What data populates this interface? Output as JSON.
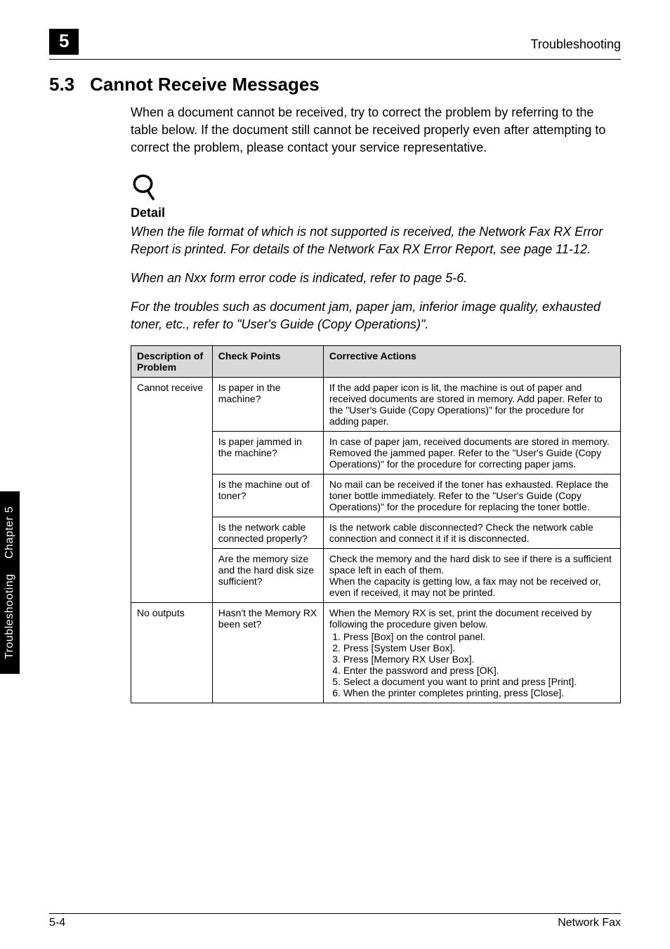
{
  "header": {
    "badge": "5",
    "label": "Troubleshooting"
  },
  "section": {
    "number": "5.3",
    "title": "Cannot Receive Messages"
  },
  "intro_paragraph": "When a document cannot be received, try to correct the problem by referring to the table below. If the document still cannot be received properly even after attempting to correct the problem, please contact your service representative.",
  "icon_name": "magnifier-icon",
  "detail": {
    "heading": "Detail",
    "para1": "When the file format of which is not supported is received, the Network Fax RX Error Report is printed. For details of the Network Fax RX Error Report, see page 11-12.",
    "para2": "When an Nxx form error code is indicated, refer to page 5-6.",
    "para3": "For the troubles such as document jam, paper jam, inferior image quality, exhausted toner, etc., refer to \"User's Guide (Copy Operations)\"."
  },
  "table": {
    "headers": {
      "col1": "Description of Problem",
      "col2": "Check Points",
      "col3": "Corrective Actions"
    },
    "rows": [
      {
        "problem": "Cannot receive",
        "check": "Is paper in the machine?",
        "action_text": "If the add paper icon is lit, the machine is out of paper and received documents are stored in memory. Add paper. Refer to the \"User's Guide (Copy Operations)\" for the procedure for adding paper."
      },
      {
        "problem": "",
        "check": "Is paper jammed in the machine?",
        "action_text": "In case of paper jam, received documents are stored in memory. Removed the jammed paper. Refer to the \"User's Guide (Copy Operations)\" for the procedure for correcting paper jams."
      },
      {
        "problem": "",
        "check": "Is the machine out of toner?",
        "action_text": "No mail can be received if the toner has exhausted. Replace the toner bottle immediately. Refer to the \"User's Guide (Copy Operations)\" for the procedure for replacing the toner bottle."
      },
      {
        "problem": "",
        "check": "Is the network cable connected properly?",
        "action_text": "Is the network cable disconnected? Check the network cable connection and connect it if it is disconnected."
      },
      {
        "problem": "",
        "check": "Are the memory size and the hard disk size sufficient?",
        "action_text": "Check the memory and the hard disk to see if there is a sufficient space left in each of them.\nWhen the capacity is getting low, a fax may not be received or, even if received, it may not be printed."
      },
      {
        "problem": "No outputs",
        "check": "Hasn't the Memory RX been set?",
        "action_text": "When the Memory RX is set, print the document received by following the procedure given below.",
        "action_list": [
          "Press [Box] on the control panel.",
          "Press [System User Box].",
          "Press [Memory RX User Box].",
          "Enter the password and press [OK].",
          "Select a document you want to print and press [Print].",
          "When the printer completes printing, press [Close]."
        ]
      }
    ]
  },
  "side_tab": {
    "top": "Troubleshooting",
    "bottom": "Chapter 5"
  },
  "footer": {
    "left": "5-4",
    "right": "Network Fax"
  }
}
